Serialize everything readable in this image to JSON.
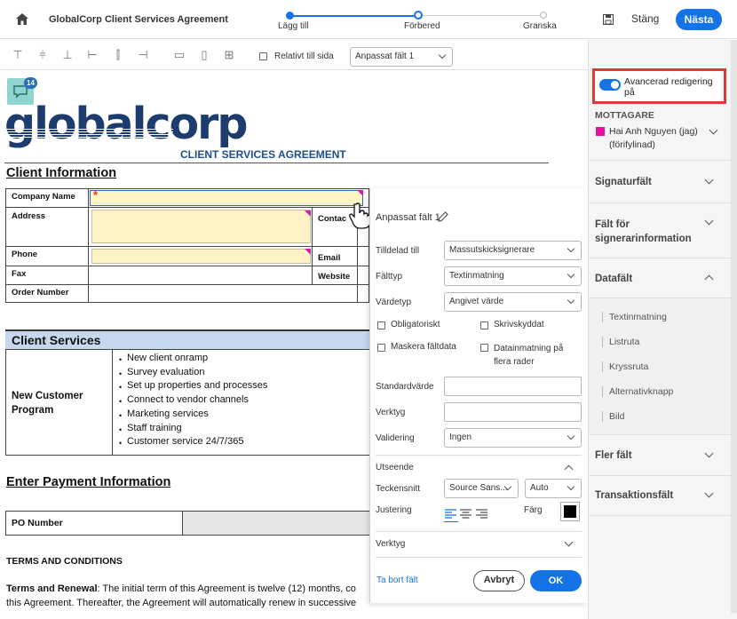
{
  "header": {
    "title": "GlobalCorp Client Services Agreement",
    "steps": [
      "Lägg till",
      "Förbered",
      "Granska"
    ],
    "close_label": "Stäng",
    "next_label": "Nästa"
  },
  "toolbar": {
    "relative_label": "Relativt till sida",
    "field_select": "Anpassat fält 1"
  },
  "comment_badge": "14",
  "document": {
    "logo_text": "globalcorp",
    "subtitle": "CLIENT SERVICES AGREEMENT",
    "client_info_heading": "Client Information",
    "company_name": "Company Name",
    "address": "Address",
    "contact": "Contac",
    "phone": "Phone",
    "email": "Email",
    "fax": "Fax",
    "website": "Website",
    "order_number": "Order Number",
    "client_services_heading": "Client Services",
    "program_label": "New Customer Program",
    "bullets": [
      "New client onramp",
      "Survey evaluation",
      "Set up properties and processes",
      "Connect to vendor channels",
      "Marketing services",
      "Staff training",
      "Customer service 24/7/365"
    ],
    "payment_heading": "Enter Payment Information",
    "po_number": "PO Number",
    "terms_heading": "TERMS AND CONDITIONS",
    "terms_bold": "Terms and Renewal",
    "terms_line1": ": The initial term of this Agreement is twelve (12) months, co",
    "terms_line2": "this Agreement. Thereafter, the Agreement will automatically renew in successive"
  },
  "field_panel": {
    "title": "Anpassat fält 1",
    "assigned_label": "Tilldelad till",
    "assigned_value": "Massutskicksignerare",
    "fieldtype_label": "Fälttyp",
    "fieldtype_value": "Textinmatning",
    "valuetype_label": "Värdetyp",
    "valuetype_value": "Angivet värde",
    "required_label": "Obligatoriskt",
    "readonly_label": "Skrivskyddat",
    "mask_label": "Maskera fältdata",
    "multiline_label": "Datainmatning på flera rader",
    "default_label": "Standardvärde",
    "tool_label": "Verktyg",
    "validation_label": "Validering",
    "validation_value": "Ingen",
    "appearance_label": "Utseende",
    "font_label": "Teckensnitt",
    "font_value": "Source Sans...",
    "size_value": "Auto",
    "align_label": "Justering",
    "color_label": "Färg",
    "tools_section": "Verktyg",
    "delete_label": "Ta bort fält",
    "cancel_label": "Avbryt",
    "ok_label": "OK"
  },
  "right_sidebar": {
    "advanced_label": "Avancerad redigering på",
    "recipients_heading": "MOTTAGARE",
    "recipient_name": "Hai Anh Nguyen (jag)",
    "recipient_status": "(förifylinad)",
    "sections": [
      "Signaturfält",
      "Fält för signerarinformation",
      "Datafält"
    ],
    "data_fields": [
      "Textinmatning",
      "Listruta",
      "Kryssruta",
      "Alternativknapp",
      "Bild"
    ],
    "more_sections": [
      "Fler fält",
      "Transaktionsfält"
    ],
    "accent_color": "#1473e6",
    "recipient_color": "#e8109f",
    "highlight_color": "#e53935"
  }
}
